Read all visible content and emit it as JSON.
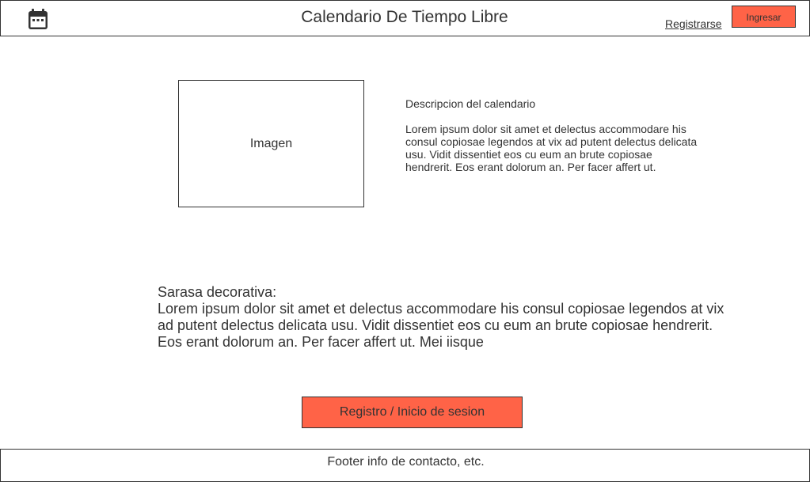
{
  "header": {
    "logo_icon": "calendar-icon",
    "title": "Calendario De Tiempo Libre",
    "register_link": "Registrarse",
    "login_button": "Ingresar"
  },
  "hero": {
    "image_placeholder": "Imagen",
    "description_title": "Descripcion del calendario",
    "description_body": "Lorem ipsum dolor sit amet et delectus accommodare his consul copiosae legendos at vix ad putent delectus delicata usu. Vidit dissentiet eos cu eum an brute copiosae hendrerit. Eos erant dolorum an. Per facer affert ut."
  },
  "decorative": {
    "heading": "Sarasa decorativa:",
    "body": "Lorem ipsum dolor sit amet et delectus accommodare his consul copiosae legendos at vix ad putent delectus delicata usu. Vidit dissentiet eos cu eum an brute copiosae hendrerit. Eos erant dolorum an. Per facer affert ut. Mei iisque"
  },
  "cta": {
    "label": "Registro / Inicio de sesion"
  },
  "footer": {
    "text": "Footer info de contacto, etc."
  },
  "colors": {
    "accent": "#ff6347",
    "border": "#333333",
    "text": "#333333"
  }
}
